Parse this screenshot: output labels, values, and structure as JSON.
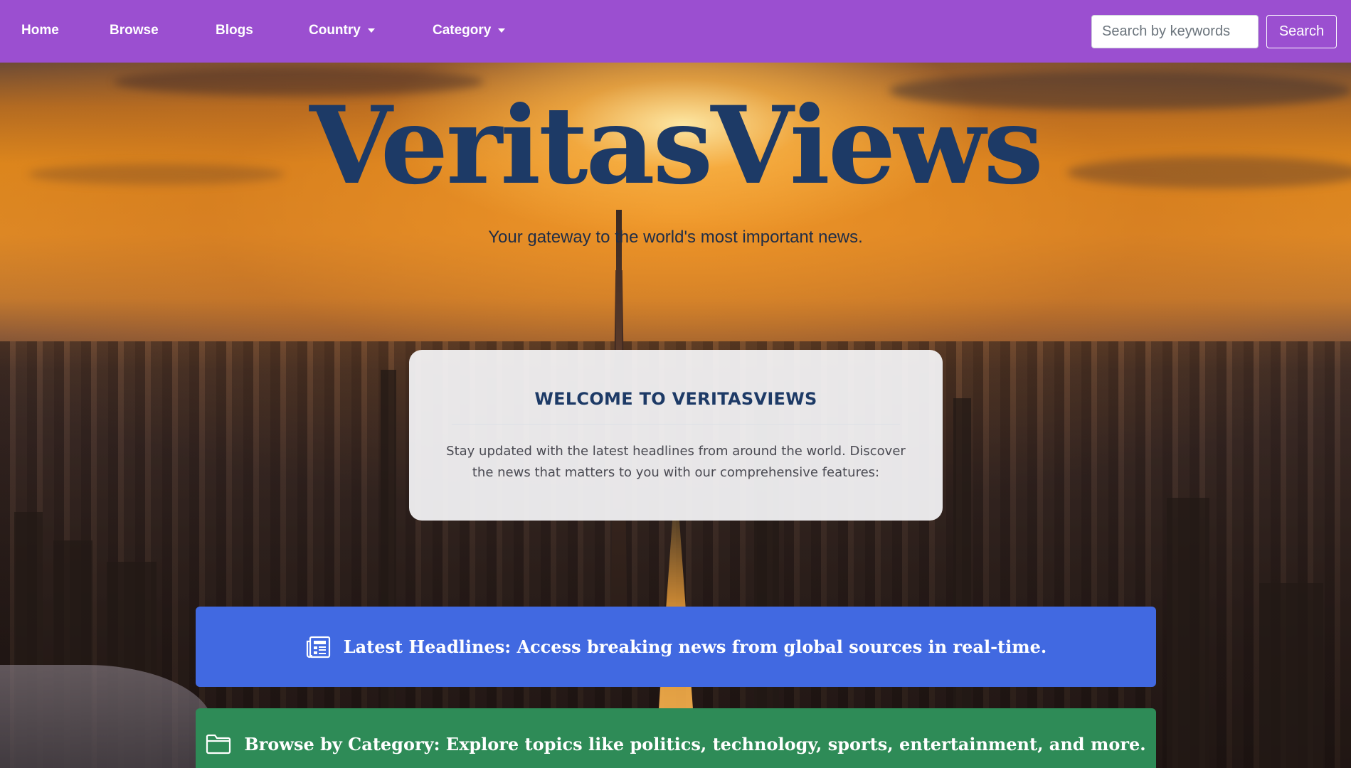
{
  "navbar": {
    "items": [
      {
        "label": "Home"
      },
      {
        "label": "Browse"
      },
      {
        "label": "Blogs"
      },
      {
        "label": "Country",
        "dropdown": true
      },
      {
        "label": "Category",
        "dropdown": true
      }
    ],
    "search": {
      "placeholder": "Search by keywords",
      "value": "",
      "button_label": "Search"
    }
  },
  "hero": {
    "title": "VeritasViews",
    "tagline": "Your gateway to the world's most important news."
  },
  "welcome": {
    "title": "WELCOME TO VERITASVIEWS",
    "text": "Stay updated with the latest headlines from around the world. Discover the news that matters to you with our comprehensive features:"
  },
  "features": [
    {
      "icon": "newspaper-icon",
      "text": "Latest Headlines: Access breaking news from global sources in real-time."
    },
    {
      "icon": "folder-icon",
      "text": "Browse by Category: Explore topics like politics, technology, sports, entertainment, and more."
    }
  ],
  "colors": {
    "navbar": "#9b4fd0",
    "title": "#1d3a66",
    "headlines_banner": "#4169e1",
    "category_banner": "#2e8b57"
  }
}
